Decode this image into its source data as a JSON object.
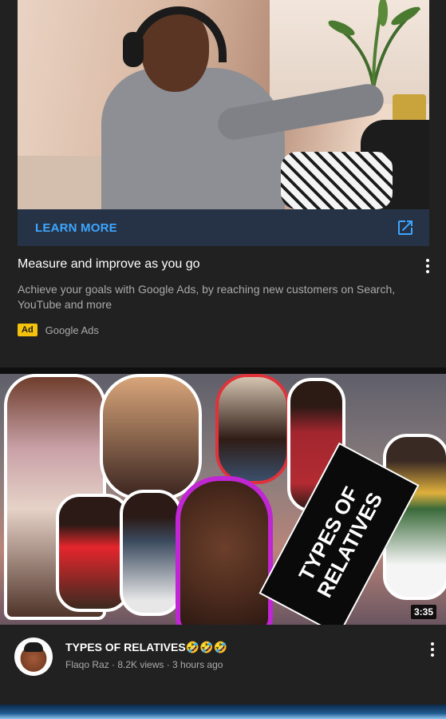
{
  "ad": {
    "cta_label": "LEARN MORE",
    "title": "Measure and improve as you go",
    "description": "Achieve your goals with Google Ads, by reaching new customers on Search, YouTube and more",
    "badge": "Ad",
    "advertiser": "Google Ads"
  },
  "video": {
    "thumbnail_text": "TYPES OF RELATIVES",
    "duration": "3:35",
    "title": "TYPES OF RELATIVES🤣🤣🤣",
    "channel_meta": "Flaqo Raz · 8.2K views · 3 hours ago"
  },
  "colors": {
    "background": "#212121",
    "cta_text": "#3ea6ff",
    "cta_bar": "#263245",
    "ad_badge": "#f4c20d",
    "secondary_text": "#aaaaaa"
  },
  "icons": {
    "cta": "external-link-icon",
    "menu": "more-vert-icon"
  }
}
